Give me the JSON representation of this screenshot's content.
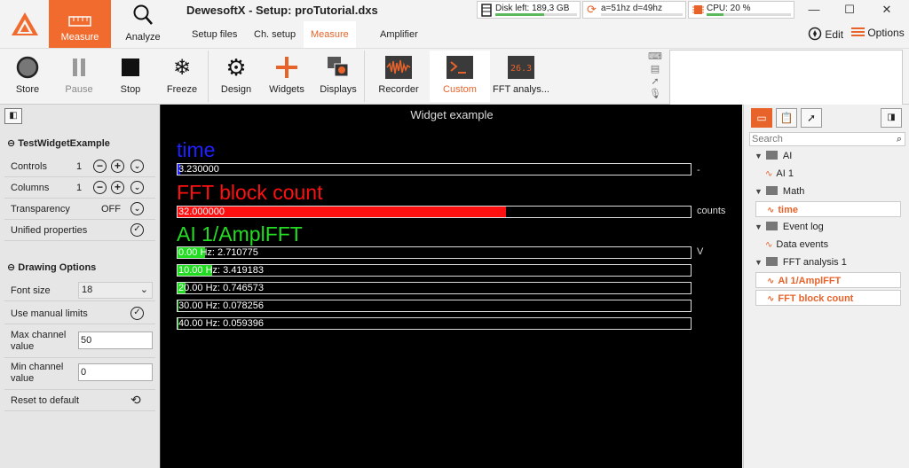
{
  "app": {
    "title": "DewesoftX - Setup: proTutorial.dxs",
    "modes": [
      {
        "label": "Measure"
      },
      {
        "label": "Analyze"
      }
    ],
    "tabs": [
      "Setup files",
      "Ch. setup",
      "Measure",
      "Amplifier"
    ],
    "active_tab": "Measure",
    "status": {
      "disk": {
        "text": "Disk left: 189,3 GB",
        "fraction": 0.6,
        "color": "#5cb85c"
      },
      "rate": {
        "text": "a=51hz d=49hz",
        "fraction": 0,
        "color": "#5cb85c"
      },
      "cpu": {
        "text": "CPU: 20 %",
        "fraction": 0.2,
        "color": "#5cb85c"
      }
    },
    "window": {
      "minimize": "—",
      "maximize": "☐",
      "close": "✕"
    },
    "edit_label": "Edit",
    "options_label": "Options"
  },
  "toolbar": {
    "store": "Store",
    "pause": "Pause",
    "stop": "Stop",
    "freeze": "Freeze",
    "design": "Design",
    "widgets": "Widgets",
    "displays": "Displays",
    "recorder": "Recorder",
    "custom": "Custom",
    "fft": "FFT analys..."
  },
  "left": {
    "collapse_icon": "◧",
    "section1": "TestWidgetExample",
    "controls_label": "Controls",
    "controls_value": "1",
    "columns_label": "Columns",
    "columns_value": "1",
    "transparency_label": "Transparency",
    "transparency_value": "OFF",
    "unified_label": "Unified properties",
    "section2": "Drawing Options",
    "font_size_label": "Font size",
    "font_size_value": "18",
    "manual_limits_label": "Use manual limits",
    "max_label_1": "Max channel",
    "max_label_2": "value",
    "max_value": "50",
    "min_label_1": "Min channel",
    "min_label_2": "value",
    "min_value": "0",
    "reset_label": "Reset to default"
  },
  "canvas": {
    "title": "Widget example",
    "channels": [
      {
        "name": "time",
        "color": "#2020ff",
        "bars": [
          {
            "text": "3.230000",
            "fraction": 0.005,
            "fill": "#2020ff"
          }
        ],
        "unit": "-"
      },
      {
        "name": "FFT block count",
        "color": "#ff1010",
        "bars": [
          {
            "text": "32.000000",
            "fraction": 0.64,
            "fill": "#ff1010"
          }
        ],
        "unit": "counts"
      },
      {
        "name": "AI 1/AmplFFT",
        "color": "#22dd22",
        "bars": [
          {
            "text": "0.00 Hz: 2.710775",
            "fraction": 0.054,
            "fill": "#22dd22"
          },
          {
            "text": "10.00 Hz: 3.419183",
            "fraction": 0.068,
            "fill": "#22dd22"
          },
          {
            "text": "20.00 Hz: 0.746573",
            "fraction": 0.015,
            "fill": "#22dd22"
          },
          {
            "text": "30.00 Hz: 0.078256",
            "fraction": 0.0016,
            "fill": "#22dd22"
          },
          {
            "text": "40.00 Hz: 0.059396",
            "fraction": 0.0012,
            "fill": "#22dd22"
          }
        ],
        "unit": "V"
      }
    ]
  },
  "right": {
    "search_placeholder": "Search",
    "tree": [
      {
        "kind": "group",
        "label": "AI"
      },
      {
        "kind": "channel",
        "label": "AI 1",
        "selected": false
      },
      {
        "kind": "group",
        "label": "Math"
      },
      {
        "kind": "channel",
        "label": "time",
        "selected": true
      },
      {
        "kind": "group",
        "label": "Event log"
      },
      {
        "kind": "channel",
        "label": "Data events",
        "selected": false
      },
      {
        "kind": "group",
        "label": "FFT analysis 1"
      },
      {
        "kind": "channel",
        "label": "AI 1/AmplFFT",
        "selected": true
      },
      {
        "kind": "channel",
        "label": "FFT block count",
        "selected": true
      }
    ]
  }
}
